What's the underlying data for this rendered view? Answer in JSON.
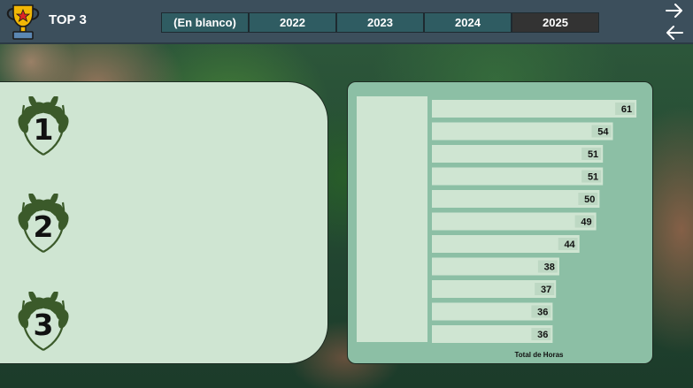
{
  "header": {
    "title": "TOP 3",
    "trophy_icon": "trophy-icon",
    "year_slicer": {
      "options": [
        "(En blanco)",
        "2022",
        "2023",
        "2024",
        "2025"
      ],
      "selected": "2025"
    },
    "nav": {
      "next_icon": "arrow-right-icon",
      "prev_icon": "arrow-left-icon"
    }
  },
  "ranks": {
    "first": "1",
    "second": "2",
    "third": "3",
    "wreath_color": "#3b5a2a"
  },
  "chart_data": {
    "type": "bar",
    "orientation": "horizontal",
    "categories": [
      "",
      "",
      "",
      "",
      "",
      "",
      "",
      "",
      "",
      "",
      ""
    ],
    "values": [
      61,
      54,
      51,
      51,
      50,
      49,
      44,
      38,
      37,
      36,
      36
    ],
    "xlabel": "Total de Horas",
    "xlim": [
      0,
      66
    ],
    "data_labels": true,
    "bar_color": "#cfe5d2",
    "panel_color": "#8cbfa5"
  }
}
